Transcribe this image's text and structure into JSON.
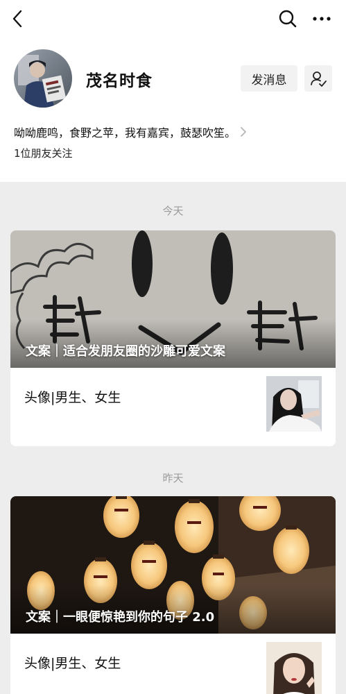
{
  "nav": {
    "back_icon": "chevron-left-icon",
    "search_icon": "search-icon",
    "more_icon": "more-dots-icon"
  },
  "account": {
    "name": "茂名时食",
    "message_button": "发消息",
    "profile_icon": "user-profile-icon",
    "intro": "呦呦鹿鸣，食野之苹，我有嘉宾，鼓瑟吹笙。",
    "followers": "1位朋友关注"
  },
  "feed": [
    {
      "day": "今天",
      "cover_title": "文案｜适合发朋友圈的沙雕可爱文案",
      "sub_title": "头像|男生、女生"
    },
    {
      "day": "昨天",
      "cover_title": "文案｜一眼便惊艳到你的句子 2.0",
      "sub_title": "头像|男生、女生"
    }
  ],
  "colors": {
    "page_background": "#ededed",
    "card_background": "#ffffff",
    "button_background": "#f2f2f2",
    "muted_text": "#9a9a9a"
  }
}
